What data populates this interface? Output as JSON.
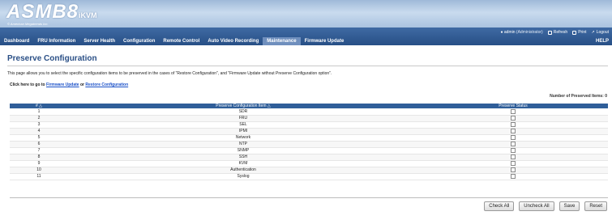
{
  "brand": {
    "title": "ASMB8",
    "suffix": "iKVM",
    "tagline": "© American Megatrends Inc."
  },
  "userbar": {
    "user": "admin",
    "role": "(Administrator)",
    "refresh": "Refresh",
    "print": "Print",
    "logout": "Logout"
  },
  "nav": {
    "items": [
      "Dashboard",
      "FRU Information",
      "Server Health",
      "Configuration",
      "Remote Control",
      "Auto Video Recording",
      "Maintenance",
      "Firmware Update"
    ],
    "active": "Maintenance",
    "help": "HELP"
  },
  "page": {
    "title": "Preserve Configuration",
    "description": "This page allows you to select the specific configuration items to be preserved in the cases of \"Restore Configuration\", and \"Firmware Update without Preserve Configuration option\".",
    "links_prefix": "Click here to go to",
    "link_firmware": "Firmware Update",
    "links_or": "or",
    "link_restore": "Restore Configuration",
    "preserved_count_label": "Number of Preserved Items: 0"
  },
  "table": {
    "headers": {
      "num": "# △",
      "item": "Preserve Configuration Item △",
      "status": "Preserve Status"
    },
    "rows": [
      {
        "num": "1",
        "item": "SDR"
      },
      {
        "num": "2",
        "item": "FRU"
      },
      {
        "num": "3",
        "item": "SEL"
      },
      {
        "num": "4",
        "item": "IPMI"
      },
      {
        "num": "5",
        "item": "Network"
      },
      {
        "num": "6",
        "item": "NTP"
      },
      {
        "num": "7",
        "item": "SNMP"
      },
      {
        "num": "8",
        "item": "SSH"
      },
      {
        "num": "9",
        "item": "KVM"
      },
      {
        "num": "10",
        "item": "Authentication"
      },
      {
        "num": "11",
        "item": "Syslog"
      }
    ]
  },
  "buttons": {
    "check_all": "Check All",
    "uncheck_all": "Uncheck All",
    "save": "Save",
    "reset": "Reset"
  }
}
